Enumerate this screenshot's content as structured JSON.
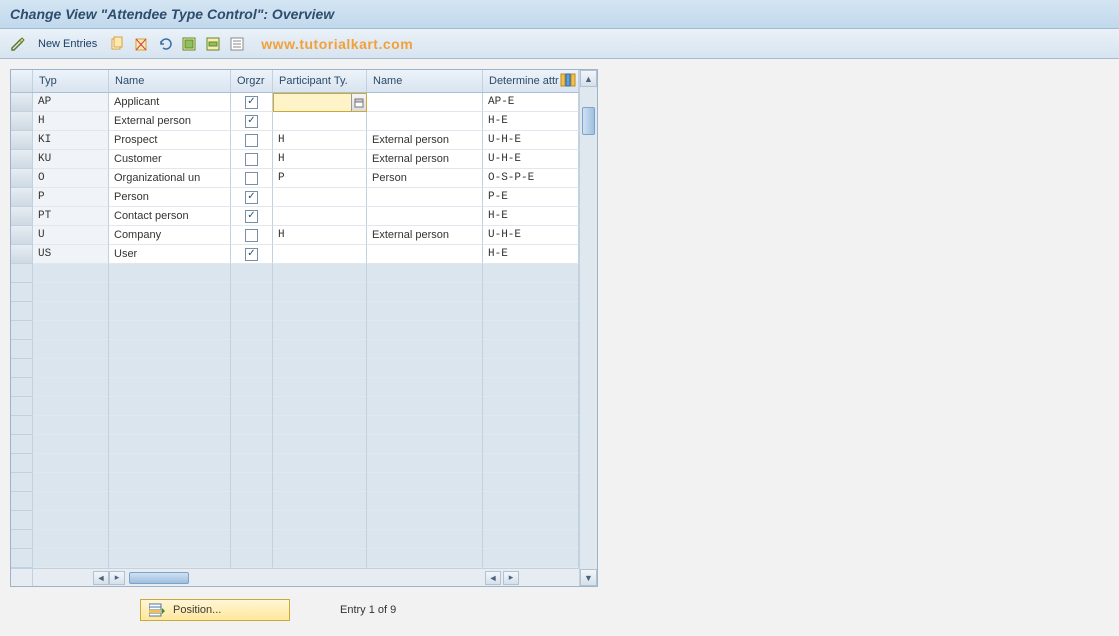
{
  "title": "Change View \"Attendee Type Control\": Overview",
  "toolbar": {
    "new_entries": "New Entries"
  },
  "watermark": "www.tutorialkart.com",
  "columns": {
    "typ": "Typ",
    "name": "Name",
    "orgzr": "Orgzr",
    "partty": "Participant Ty.",
    "name2": "Name",
    "attr": "Determine attr"
  },
  "rows": [
    {
      "typ": "AP",
      "name": "Applicant",
      "orgzr": true,
      "partty": "",
      "name2": "",
      "attr": "AP-E",
      "active": true
    },
    {
      "typ": "H",
      "name": "External person",
      "orgzr": true,
      "partty": "",
      "name2": "",
      "attr": "H-E"
    },
    {
      "typ": "KI",
      "name": "Prospect",
      "orgzr": false,
      "partty": "H",
      "name2": "External person",
      "attr": "U-H-E"
    },
    {
      "typ": "KU",
      "name": "Customer",
      "orgzr": false,
      "partty": "H",
      "name2": "External person",
      "attr": "U-H-E"
    },
    {
      "typ": "O",
      "name": "Organizational un",
      "orgzr": false,
      "partty": "P",
      "name2": "Person",
      "attr": "O-S-P-E"
    },
    {
      "typ": "P",
      "name": "Person",
      "orgzr": true,
      "partty": "",
      "name2": "",
      "attr": "P-E"
    },
    {
      "typ": "PT",
      "name": "Contact person",
      "orgzr": true,
      "partty": "",
      "name2": "",
      "attr": "H-E"
    },
    {
      "typ": "U",
      "name": "Company",
      "orgzr": false,
      "partty": "H",
      "name2": "External person",
      "attr": "U-H-E"
    },
    {
      "typ": "US",
      "name": "User",
      "orgzr": true,
      "partty": "",
      "name2": "",
      "attr": "H-E"
    }
  ],
  "empty_rows": 16,
  "footer": {
    "position_label": "Position...",
    "entry_text": "Entry 1 of 9"
  }
}
